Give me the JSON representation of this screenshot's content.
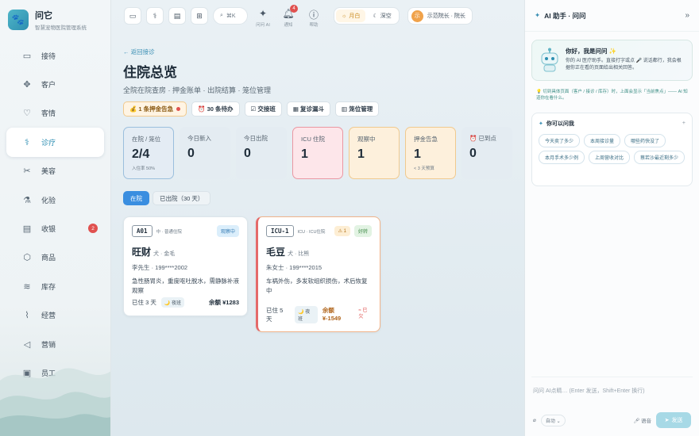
{
  "app": {
    "name": "问它",
    "subtitle": "智慧宠物医院管理系统",
    "logo_icon": "paw-icon"
  },
  "sidebar": {
    "items": [
      {
        "label": "接待",
        "icon": "reception-icon",
        "glyph": "▭"
      },
      {
        "label": "客户",
        "icon": "customers-icon",
        "glyph": "✥"
      },
      {
        "label": "客情",
        "icon": "heart-icon",
        "glyph": "♡"
      },
      {
        "label": "诊疗",
        "icon": "stethoscope-icon",
        "glyph": "⚕",
        "active": true
      },
      {
        "label": "美容",
        "icon": "scissors-icon",
        "glyph": "✂"
      },
      {
        "label": "化验",
        "icon": "flask-icon",
        "glyph": "⚗"
      },
      {
        "label": "收银",
        "icon": "cashier-icon",
        "glyph": "▤",
        "badge": "2"
      },
      {
        "label": "商品",
        "icon": "box-icon",
        "glyph": "⬡"
      },
      {
        "label": "库存",
        "icon": "layers-icon",
        "glyph": "≋"
      },
      {
        "label": "经营",
        "icon": "chart-icon",
        "glyph": "⌇"
      },
      {
        "label": "营销",
        "icon": "megaphone-icon",
        "glyph": "◁"
      },
      {
        "label": "员工",
        "icon": "staff-icon",
        "glyph": "▣"
      }
    ]
  },
  "topbar": {
    "buttons": [
      {
        "name": "card-icon",
        "glyph": "▭"
      },
      {
        "name": "stethoscope-icon",
        "glyph": "⚕"
      },
      {
        "name": "message-icon",
        "glyph": "▤"
      },
      {
        "name": "gift-icon",
        "glyph": "⊞"
      }
    ],
    "search_shortcut": "⌘K",
    "ask_ai_label": "问问 AI",
    "notify_label": "通知",
    "notify_count": "4",
    "help_label": "帮助",
    "theme": {
      "light": "月白",
      "dark": "深空"
    },
    "user": {
      "avatar": "示",
      "name": "示范院长 · 院长"
    }
  },
  "main": {
    "back": "← 返回接诊",
    "title": "住院总览",
    "subtitle": "全院在院查房 · 押金账单 · 出院结算 · 笼位管理",
    "chips": {
      "deposit_alert": "💰 1 条押金告急",
      "pending": "⏰ 30 条待办",
      "handover": "☑ 交接班",
      "review": "▦ 复诊漏斗",
      "cage": "▥ 笼位管理"
    },
    "stats": [
      {
        "label": "在院 / 笼位",
        "value": "2/4",
        "sub": "入住率 50%",
        "style": "sel"
      },
      {
        "label": "今日新入",
        "value": "0",
        "sub": "",
        "style": ""
      },
      {
        "label": "今日出院",
        "value": "0",
        "sub": "",
        "style": ""
      },
      {
        "label": "ICU 住院",
        "value": "1",
        "sub": "",
        "style": "icu"
      },
      {
        "label": "观察中",
        "value": "1",
        "sub": "",
        "style": "obs"
      },
      {
        "label": "押金告急",
        "value": "1",
        "sub": "< 3 天预算",
        "style": "dep"
      },
      {
        "label": "⏰ 已到点",
        "value": "0",
        "sub": "",
        "style": ""
      }
    ],
    "tabs": {
      "current": "在院",
      "discharged": "已出院（30 天）"
    },
    "cards": [
      {
        "bed": "A01",
        "ward": "中 · 普通住院",
        "status": "观察中",
        "pet": "旺财",
        "pet_info": "犬 · 金毛",
        "owner": "李先生 · 199****2002",
        "diagnosis": "急性肠胃炎，重度呕吐脱水，需静脉补液观察",
        "days": "已住 3 天",
        "shift": "🌙 夜班",
        "balance": "余额 ¥1283"
      },
      {
        "bed": "ICU-1",
        "ward": "ICU · ICU住院",
        "warn": "⚠ 1",
        "status": "好转",
        "pet": "毛豆",
        "pet_info": "犬 · 比熊",
        "owner": "朱女士 · 199****2015",
        "diagnosis": "车祸外伤，多发软组织损伤，术后恢复中",
        "days": "已住 5 天",
        "shift": "🌙 夜班",
        "balance": "余额 ¥-1549",
        "overdue": "≈ 已欠"
      }
    ]
  },
  "ai": {
    "title": "AI 助手 · 问问",
    "greet_title": "你好，我是问问 ✨",
    "greet_body": "你的 AI 医疗助手。直接打字或点 🎤 说话都行，我会根据你正在看的页面给出相关回答。",
    "hint": "💡 切到具体页面（客户 / 接诊 / 库存）时，上面会显示「当前焦点」—— AI 知道你在看什么。",
    "ask_title": "你可以问我",
    "questions": [
      "今天卖了多少",
      "本周接诊量",
      "哪些药快没了",
      "本月手术多少例",
      "上周营收对比",
      "蔡若沙最近剩多少"
    ],
    "input_placeholder": "问问 AI点睛… (Enter 发送，Shift+Enter 换行)",
    "auto_label": "自动",
    "voice_label": "语音",
    "send_label": "发送"
  }
}
